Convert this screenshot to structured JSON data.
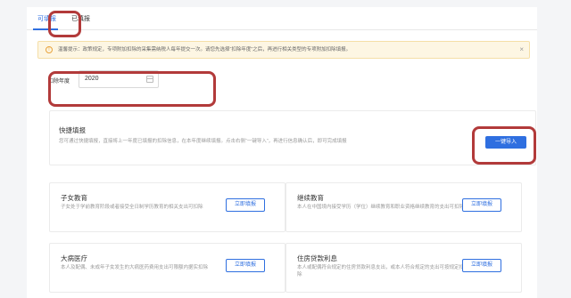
{
  "tabs": [
    {
      "label": "可填报"
    },
    {
      "label": "已填报"
    }
  ],
  "notice": {
    "icon": "info-icon",
    "text": "温馨提示：政策规定，专项附加扣除的采集需纳税人每年提交一次。请您先选择“扣除年度”之后，再进行相关类型的专项附加扣除填报。",
    "close": "×"
  },
  "year": {
    "label": "扣除年度",
    "value": "2020"
  },
  "quick_fill": {
    "title": "快捷填报",
    "desc": "您可通过快捷填报，直接将上一年度已填报的扣除信息，在本年度继续填报。点击右侧“一键导入”，再进行信息确认后，即可完成填报",
    "button": "一键导入"
  },
  "categories": [
    {
      "title": "子女教育",
      "desc": "子女处于学前教育阶段或者接受全日制学历教育的相关支出可扣除",
      "button": "立即填报"
    },
    {
      "title": "继续教育",
      "desc": "本人在中国境内接受学历（学位）继续教育和职业资格继续教育的支出可扣除",
      "button": "立即填报"
    },
    {
      "title": "大病医疗",
      "desc": "本人及配偶、未成年子女发生的大病医药费用支出可限额内据实扣除",
      "button": "立即填报"
    },
    {
      "title": "住房贷款利息",
      "desc": "本人或配偶符合规定的住房贷款利息支出，或本人符合规定的支出可按规定扣除",
      "button": "立即填报"
    }
  ],
  "colors": {
    "accent": "#2f6fe0",
    "highlight": "#b23a3a",
    "notice_bg": "#fdf6e3"
  }
}
